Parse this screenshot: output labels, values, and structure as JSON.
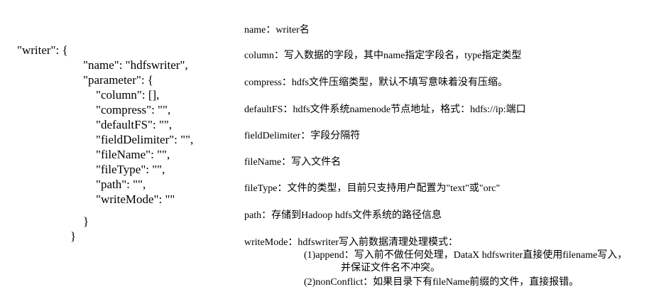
{
  "code": {
    "lines": [
      "\"writer\": {",
      "\"name\": \"hdfswriter\",",
      "\"parameter\": {",
      "\"column\": [],",
      "\"compress\": \"\",",
      "\"defaultFS\": \"\",",
      "\"fieldDelimiter\": \"\",",
      "\"fileName\": \"\",",
      "\"fileType\": \"\",",
      "\"path\": \"\",",
      "\"writeMode\": \"\"",
      "}",
      "}"
    ]
  },
  "descriptions": {
    "name": "name：writer名",
    "column": "column：写入数据的字段，其中name指定字段名，type指定类型",
    "compress": "compress：hdfs文件压缩类型，默认不填写意味着没有压缩。",
    "defaultFS": "defaultFS：hdfs文件系统namenode节点地址，格式：hdfs://ip:端口",
    "fieldDelimiter": "fieldDelimiter：字段分隔符",
    "fileName": "fileName：写入文件名",
    "fileType": "fileType：文件的类型，目前只支持用户配置为\"text\"或\"orc\"",
    "path": "path：存储到Hadoop hdfs文件系统的路径信息",
    "writeMode": "writeMode：hdfswriter写入前数据清理处理模式：",
    "writeMode_append_1": "(1)append：写入前不做任何处理，DataX hdfswriter直接使用filename写入，",
    "writeMode_append_2": "并保证文件名不冲突。",
    "writeMode_nonConflict": "(2)nonConflict：如果目录下有fileName前缀的文件，直接报错。"
  }
}
